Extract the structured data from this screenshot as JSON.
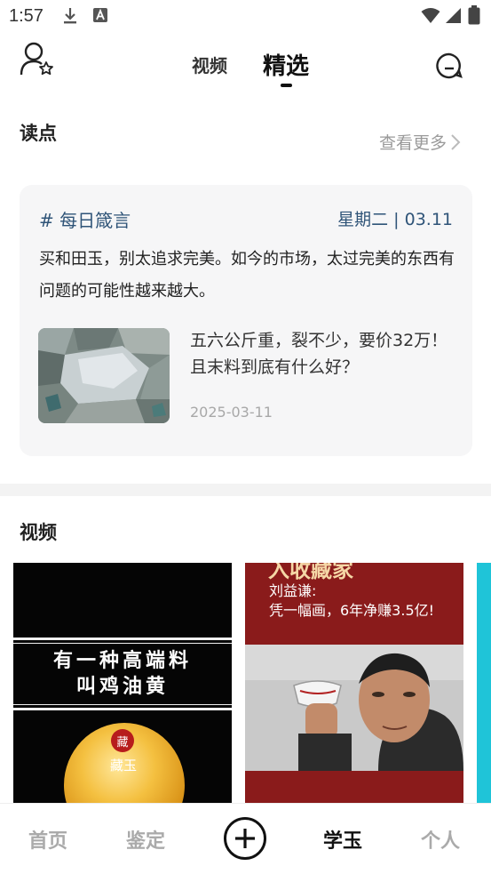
{
  "status_bar": {
    "time": "1:57",
    "icons": [
      "download-icon",
      "app-notification-icon",
      "wifi-icon",
      "signal-icon",
      "battery-icon"
    ]
  },
  "header": {
    "tabs": [
      {
        "label": "视频",
        "active": false
      },
      {
        "label": "精选",
        "active": true
      }
    ],
    "left_icon": "user-star-icon",
    "right_icon": "message-icon"
  },
  "reading": {
    "title": "读点",
    "more_label": "查看更多",
    "card": {
      "tag": "# 每日箴言",
      "date": "星期二 | 03.11",
      "quote": "买和田玉，别太追求完美。如今的市场，太过完美的东西有问题的可能性越来越大。",
      "article": {
        "title": "五六公斤重，裂不少，要价32万！且末料到底有什么好？",
        "date": "2025-03-11"
      }
    }
  },
  "videos": {
    "title": "视频",
    "items": [
      {
        "line1": "有一种高端料",
        "line2": "叫鸡油黄",
        "seal": "藏",
        "mark": "藏玉"
      },
      {
        "headline": "入收藏家",
        "name": "刘益谦:",
        "subtitle": "凭一幅画，6年净赚3.5亿!"
      },
      {}
    ]
  },
  "bottom_nav": {
    "items": [
      {
        "label": "首页",
        "active": false
      },
      {
        "label": "鉴定",
        "active": false
      },
      {
        "label": "学玉",
        "active": true
      },
      {
        "label": "个人",
        "active": false
      }
    ],
    "center_icon": "add-circle-icon"
  },
  "colors": {
    "accent_blue": "#2f5478",
    "card_bg": "#f6f6f7",
    "inactive_nav": "#aaaaaa"
  }
}
